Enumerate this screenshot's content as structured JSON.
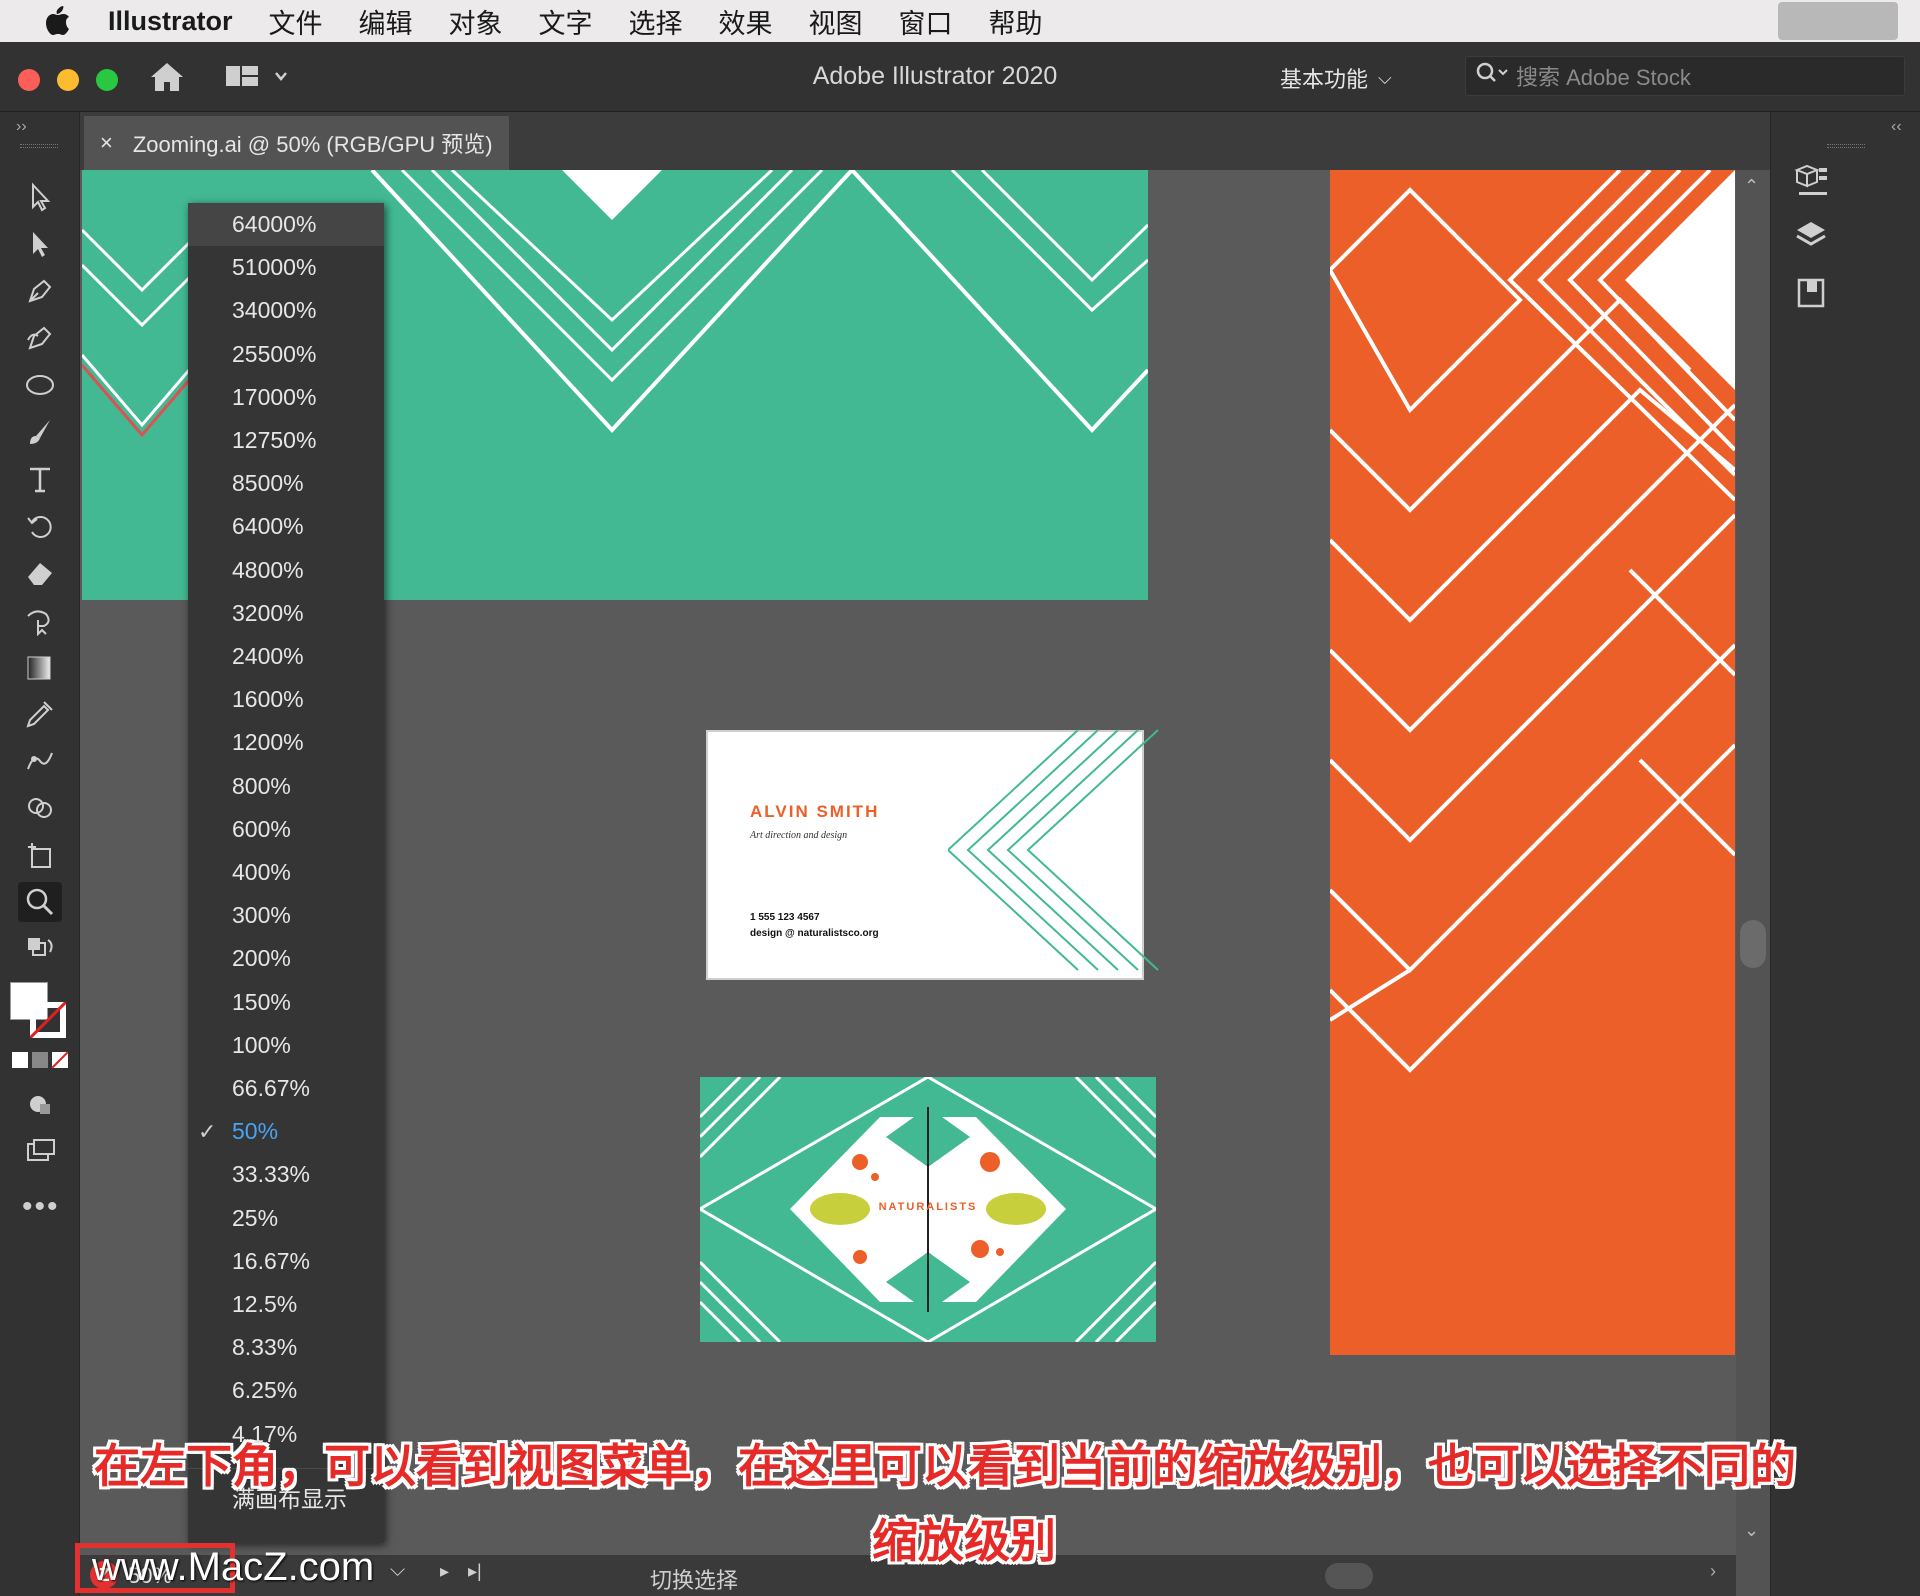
{
  "menubar": {
    "app": "Illustrator",
    "items": [
      "文件",
      "编辑",
      "对象",
      "文字",
      "选择",
      "效果",
      "视图",
      "窗口",
      "帮助"
    ]
  },
  "titlebar": {
    "title": "Adobe Illustrator 2020",
    "workspace": "基本功能",
    "search_placeholder": "搜索 Adobe Stock"
  },
  "tab": {
    "close": "×",
    "label": "Zooming.ai @ 50% (RGB/GPU 预览)"
  },
  "zoom_menu": {
    "options": [
      "64000%",
      "51000%",
      "34000%",
      "25500%",
      "17000%",
      "12750%",
      "8500%",
      "6400%",
      "4800%",
      "3200%",
      "2400%",
      "1600%",
      "1200%",
      "800%",
      "600%",
      "400%",
      "300%",
      "200%",
      "150%",
      "100%",
      "66.67%",
      "50%",
      "33.33%",
      "25%",
      "16.67%",
      "12.5%",
      "8.33%",
      "6.25%",
      "4.17%"
    ],
    "selected": "50%",
    "fit_label": "满画布显示"
  },
  "business_card": {
    "name": "ALVIN SMITH",
    "tagline": "Art direction and design",
    "phone": "1 555 123 4567",
    "email": "design @ naturalistsco.org"
  },
  "logo_card": {
    "brand": "NATURALISTS"
  },
  "statusbar": {
    "zoom_value": "50%",
    "toggle_label": "切换选择"
  },
  "caption": {
    "line1": "在左下角，可以看到视图菜单，在这里可以看到当前的缩放级别，也可以选择不同的",
    "line2": "缩放级别"
  },
  "watermark": "www.MacZ.com",
  "colors": {
    "green": "#42B993",
    "orange": "#EC5F28",
    "ui_dark": "#323232",
    "canvas": "#5a5a5a",
    "accent_blue": "#4ba3f2",
    "caption_red": "#e52a27"
  }
}
